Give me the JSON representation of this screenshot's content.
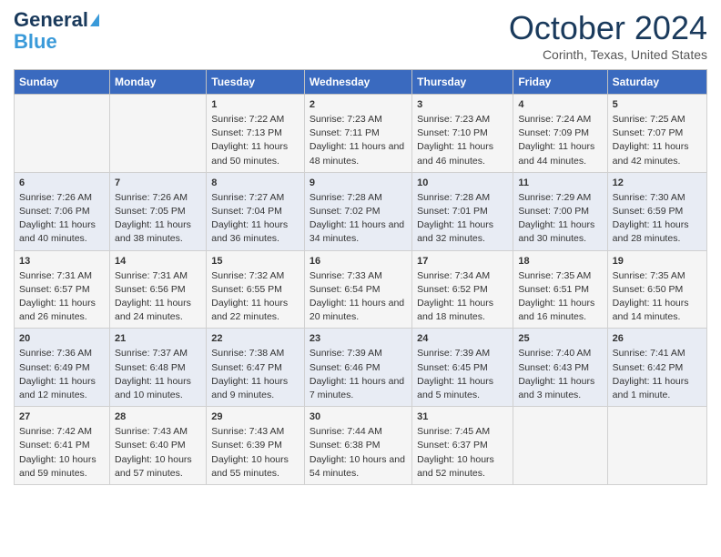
{
  "header": {
    "logo_line1": "General",
    "logo_line2": "Blue",
    "month": "October 2024",
    "location": "Corinth, Texas, United States"
  },
  "weekdays": [
    "Sunday",
    "Monday",
    "Tuesday",
    "Wednesday",
    "Thursday",
    "Friday",
    "Saturday"
  ],
  "weeks": [
    [
      {
        "day": "",
        "content": ""
      },
      {
        "day": "",
        "content": ""
      },
      {
        "day": "1",
        "content": "Sunrise: 7:22 AM\nSunset: 7:13 PM\nDaylight: 11 hours and 50 minutes."
      },
      {
        "day": "2",
        "content": "Sunrise: 7:23 AM\nSunset: 7:11 PM\nDaylight: 11 hours and 48 minutes."
      },
      {
        "day": "3",
        "content": "Sunrise: 7:23 AM\nSunset: 7:10 PM\nDaylight: 11 hours and 46 minutes."
      },
      {
        "day": "4",
        "content": "Sunrise: 7:24 AM\nSunset: 7:09 PM\nDaylight: 11 hours and 44 minutes."
      },
      {
        "day": "5",
        "content": "Sunrise: 7:25 AM\nSunset: 7:07 PM\nDaylight: 11 hours and 42 minutes."
      }
    ],
    [
      {
        "day": "6",
        "content": "Sunrise: 7:26 AM\nSunset: 7:06 PM\nDaylight: 11 hours and 40 minutes."
      },
      {
        "day": "7",
        "content": "Sunrise: 7:26 AM\nSunset: 7:05 PM\nDaylight: 11 hours and 38 minutes."
      },
      {
        "day": "8",
        "content": "Sunrise: 7:27 AM\nSunset: 7:04 PM\nDaylight: 11 hours and 36 minutes."
      },
      {
        "day": "9",
        "content": "Sunrise: 7:28 AM\nSunset: 7:02 PM\nDaylight: 11 hours and 34 minutes."
      },
      {
        "day": "10",
        "content": "Sunrise: 7:28 AM\nSunset: 7:01 PM\nDaylight: 11 hours and 32 minutes."
      },
      {
        "day": "11",
        "content": "Sunrise: 7:29 AM\nSunset: 7:00 PM\nDaylight: 11 hours and 30 minutes."
      },
      {
        "day": "12",
        "content": "Sunrise: 7:30 AM\nSunset: 6:59 PM\nDaylight: 11 hours and 28 minutes."
      }
    ],
    [
      {
        "day": "13",
        "content": "Sunrise: 7:31 AM\nSunset: 6:57 PM\nDaylight: 11 hours and 26 minutes."
      },
      {
        "day": "14",
        "content": "Sunrise: 7:31 AM\nSunset: 6:56 PM\nDaylight: 11 hours and 24 minutes."
      },
      {
        "day": "15",
        "content": "Sunrise: 7:32 AM\nSunset: 6:55 PM\nDaylight: 11 hours and 22 minutes."
      },
      {
        "day": "16",
        "content": "Sunrise: 7:33 AM\nSunset: 6:54 PM\nDaylight: 11 hours and 20 minutes."
      },
      {
        "day": "17",
        "content": "Sunrise: 7:34 AM\nSunset: 6:52 PM\nDaylight: 11 hours and 18 minutes."
      },
      {
        "day": "18",
        "content": "Sunrise: 7:35 AM\nSunset: 6:51 PM\nDaylight: 11 hours and 16 minutes."
      },
      {
        "day": "19",
        "content": "Sunrise: 7:35 AM\nSunset: 6:50 PM\nDaylight: 11 hours and 14 minutes."
      }
    ],
    [
      {
        "day": "20",
        "content": "Sunrise: 7:36 AM\nSunset: 6:49 PM\nDaylight: 11 hours and 12 minutes."
      },
      {
        "day": "21",
        "content": "Sunrise: 7:37 AM\nSunset: 6:48 PM\nDaylight: 11 hours and 10 minutes."
      },
      {
        "day": "22",
        "content": "Sunrise: 7:38 AM\nSunset: 6:47 PM\nDaylight: 11 hours and 9 minutes."
      },
      {
        "day": "23",
        "content": "Sunrise: 7:39 AM\nSunset: 6:46 PM\nDaylight: 11 hours and 7 minutes."
      },
      {
        "day": "24",
        "content": "Sunrise: 7:39 AM\nSunset: 6:45 PM\nDaylight: 11 hours and 5 minutes."
      },
      {
        "day": "25",
        "content": "Sunrise: 7:40 AM\nSunset: 6:43 PM\nDaylight: 11 hours and 3 minutes."
      },
      {
        "day": "26",
        "content": "Sunrise: 7:41 AM\nSunset: 6:42 PM\nDaylight: 11 hours and 1 minute."
      }
    ],
    [
      {
        "day": "27",
        "content": "Sunrise: 7:42 AM\nSunset: 6:41 PM\nDaylight: 10 hours and 59 minutes."
      },
      {
        "day": "28",
        "content": "Sunrise: 7:43 AM\nSunset: 6:40 PM\nDaylight: 10 hours and 57 minutes."
      },
      {
        "day": "29",
        "content": "Sunrise: 7:43 AM\nSunset: 6:39 PM\nDaylight: 10 hours and 55 minutes."
      },
      {
        "day": "30",
        "content": "Sunrise: 7:44 AM\nSunset: 6:38 PM\nDaylight: 10 hours and 54 minutes."
      },
      {
        "day": "31",
        "content": "Sunrise: 7:45 AM\nSunset: 6:37 PM\nDaylight: 10 hours and 52 minutes."
      },
      {
        "day": "",
        "content": ""
      },
      {
        "day": "",
        "content": ""
      }
    ]
  ]
}
